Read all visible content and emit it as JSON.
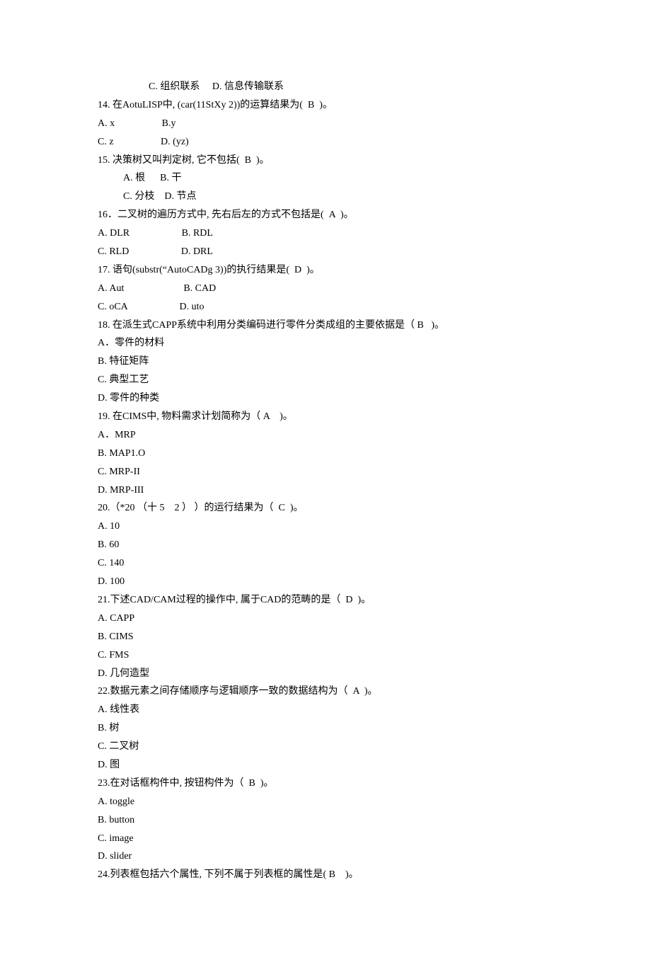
{
  "lines": [
    {
      "cls": "indent1",
      "text": "C. 组织联系     D. 信息传输联系"
    },
    {
      "cls": "",
      "text": "14. 在AotuLISP中, (car(11StXy 2))的运算结果为(  B  )。"
    },
    {
      "cls": "",
      "text": "A. x                   B.y"
    },
    {
      "cls": "",
      "text": "C. z                   D. (yz)"
    },
    {
      "cls": "",
      "text": "15. 决策树又叫判定树, 它不包括(  B  )。"
    },
    {
      "cls": "indent2",
      "text": "A. 根      B. 干"
    },
    {
      "cls": "indent2",
      "text": "C. 分枝    D. 节点"
    },
    {
      "cls": "",
      "text": "16．二叉树的遍历方式中, 先右后左的方式不包括是(  A  )。"
    },
    {
      "cls": "",
      "text": "A. DLR                     B. RDL"
    },
    {
      "cls": "",
      "text": "C. RLD                     D. DRL"
    },
    {
      "cls": "",
      "text": "17. 语句(substr(“AutoCADg 3))的执行结果是(  D  )。"
    },
    {
      "cls": "",
      "text": "A. Aut                        B. CAD"
    },
    {
      "cls": "",
      "text": "C. oCA                     D. uto"
    },
    {
      "cls": "",
      "text": "18. 在派生式CAPP系统中利用分类编码进行零件分类成组的主要依据是（ B   )。"
    },
    {
      "cls": "",
      "text": "A．零件的材料"
    },
    {
      "cls": "",
      "text": "B. 特征矩阵"
    },
    {
      "cls": "",
      "text": "C. 典型工艺"
    },
    {
      "cls": "",
      "text": "D. 零件的种类"
    },
    {
      "cls": "",
      "text": "19. 在CIMS中, 物料需求计划简称为（ A    )。"
    },
    {
      "cls": "",
      "text": "A．MRP"
    },
    {
      "cls": "",
      "text": "B. MAP1.O"
    },
    {
      "cls": "",
      "text": "C. MRP-II"
    },
    {
      "cls": "",
      "text": "D. MRP-III"
    },
    {
      "cls": "",
      "text": "20.（*20 （十 5    2 ） ）的运行结果为（  C  )。"
    },
    {
      "cls": "",
      "text": "A. 10"
    },
    {
      "cls": "",
      "text": "B. 60"
    },
    {
      "cls": "",
      "text": "C. 140"
    },
    {
      "cls": "",
      "text": "D. 100"
    },
    {
      "cls": "",
      "text": "21.下述CAD/CAM过程的操作中, 属于CAD的范畴的是（  D  )。"
    },
    {
      "cls": "",
      "text": "A. CAPP"
    },
    {
      "cls": "",
      "text": "B. CIMS"
    },
    {
      "cls": "",
      "text": "C. FMS"
    },
    {
      "cls": "",
      "text": "D. 几何造型"
    },
    {
      "cls": "",
      "text": "22.数据元素之间存储顺序与逻辑顺序一致的数据结构为（  A  )。"
    },
    {
      "cls": "",
      "text": "A. 线性表"
    },
    {
      "cls": "",
      "text": "B. 树"
    },
    {
      "cls": "",
      "text": "C. 二叉树"
    },
    {
      "cls": "",
      "text": "D. 图"
    },
    {
      "cls": "",
      "text": "23.在对话框构件中, 按钮构件为（  B  )。"
    },
    {
      "cls": "",
      "text": "A. toggle"
    },
    {
      "cls": "",
      "text": "B. button"
    },
    {
      "cls": "",
      "text": "C. image"
    },
    {
      "cls": "",
      "text": "D. slider"
    },
    {
      "cls": "",
      "text": "24.列表框包括六个属性, 下列不属于列表框的属性是( B    )。"
    }
  ]
}
